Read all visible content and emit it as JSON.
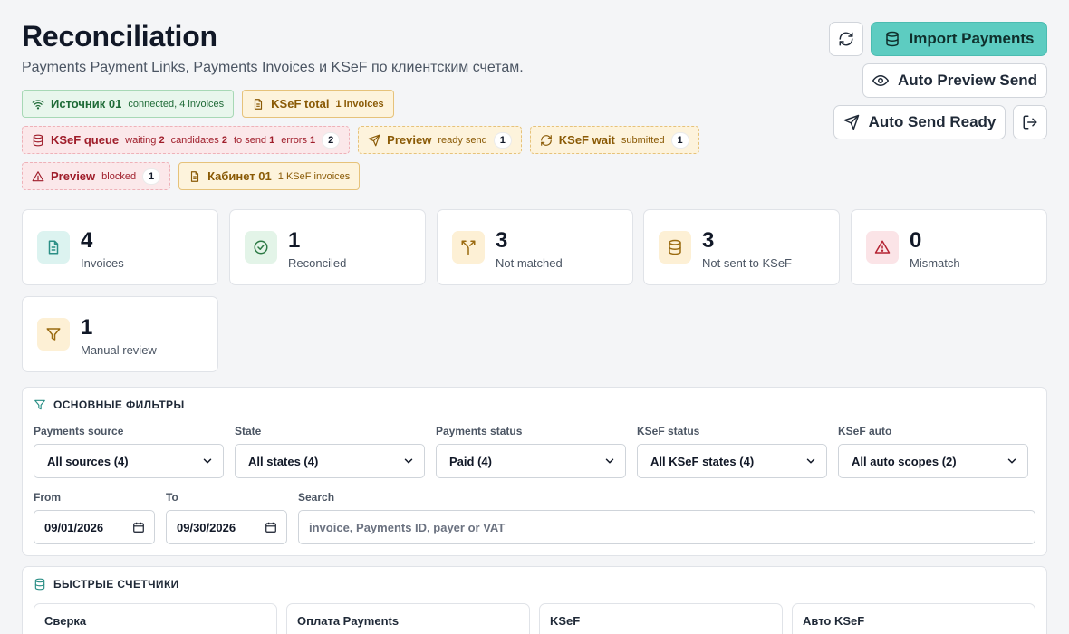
{
  "header": {
    "title": "Reconciliation",
    "subtitle": "Payments Payment Links, Payments Invoices и KSeF по клиентским счетам."
  },
  "actions": {
    "import_label": "Import Payments",
    "auto_preview_label": "Auto Preview Send",
    "auto_send_label": "Auto Send Ready"
  },
  "chips": {
    "source": {
      "label": "Источник 01",
      "sub": "connected, 4 invoices"
    },
    "ksef_total": {
      "label": "KSeF total",
      "sub": "1 invoices"
    },
    "ksef_queue": {
      "label": "KSeF queue",
      "waiting_label": "waiting",
      "waiting_value": "2",
      "candidates_label": "candidates",
      "candidates_value": "2",
      "tosend_label": "to send",
      "tosend_value": "1",
      "errors_label": "errors",
      "errors_value": "1",
      "count": "2"
    },
    "preview_ready": {
      "label": "Preview",
      "sub": "ready send",
      "count": "1"
    },
    "ksef_wait": {
      "label": "KSeF wait",
      "sub": "submitted",
      "count": "1"
    },
    "preview_blocked": {
      "label": "Preview",
      "sub": "blocked",
      "count": "1"
    },
    "cabinet": {
      "label": "Кабинет 01",
      "sub": "1 KSeF invoices"
    }
  },
  "stats": {
    "invoices": {
      "value": "4",
      "label": "Invoices"
    },
    "reconciled": {
      "value": "1",
      "label": "Reconciled"
    },
    "not_matched": {
      "value": "3",
      "label": "Not matched"
    },
    "not_sent": {
      "value": "3",
      "label": "Not sent to KSeF"
    },
    "mismatch": {
      "value": "0",
      "label": "Mismatch"
    },
    "manual": {
      "value": "1",
      "label": "Manual review"
    }
  },
  "filters": {
    "title": "ОСНОВНЫЕ ФИЛЬТРЫ",
    "source": {
      "label": "Payments source",
      "value": "All sources (4)"
    },
    "state": {
      "label": "State",
      "value": "All states (4)"
    },
    "payments_status": {
      "label": "Payments status",
      "value": "Paid (4)"
    },
    "ksef_status": {
      "label": "KSeF status",
      "value": "All KSeF states (4)"
    },
    "ksef_auto": {
      "label": "KSeF auto",
      "value": "All auto scopes (2)"
    },
    "from": {
      "label": "From",
      "value": "09/01/2026"
    },
    "to": {
      "label": "To",
      "value": "09/30/2026"
    },
    "search": {
      "label": "Search",
      "placeholder": "invoice, Payments ID, payer or VAT"
    }
  },
  "counters": {
    "title": "БЫСТРЫЕ СЧЕТЧИКИ",
    "groups": [
      "Сверка",
      "Оплата Payments",
      "KSeF",
      "Авто KSeF"
    ]
  },
  "colors": {
    "accent": "#5dccc1",
    "green": "#1f6b37",
    "amber": "#8a5a06",
    "red": "#9f1d2a"
  }
}
